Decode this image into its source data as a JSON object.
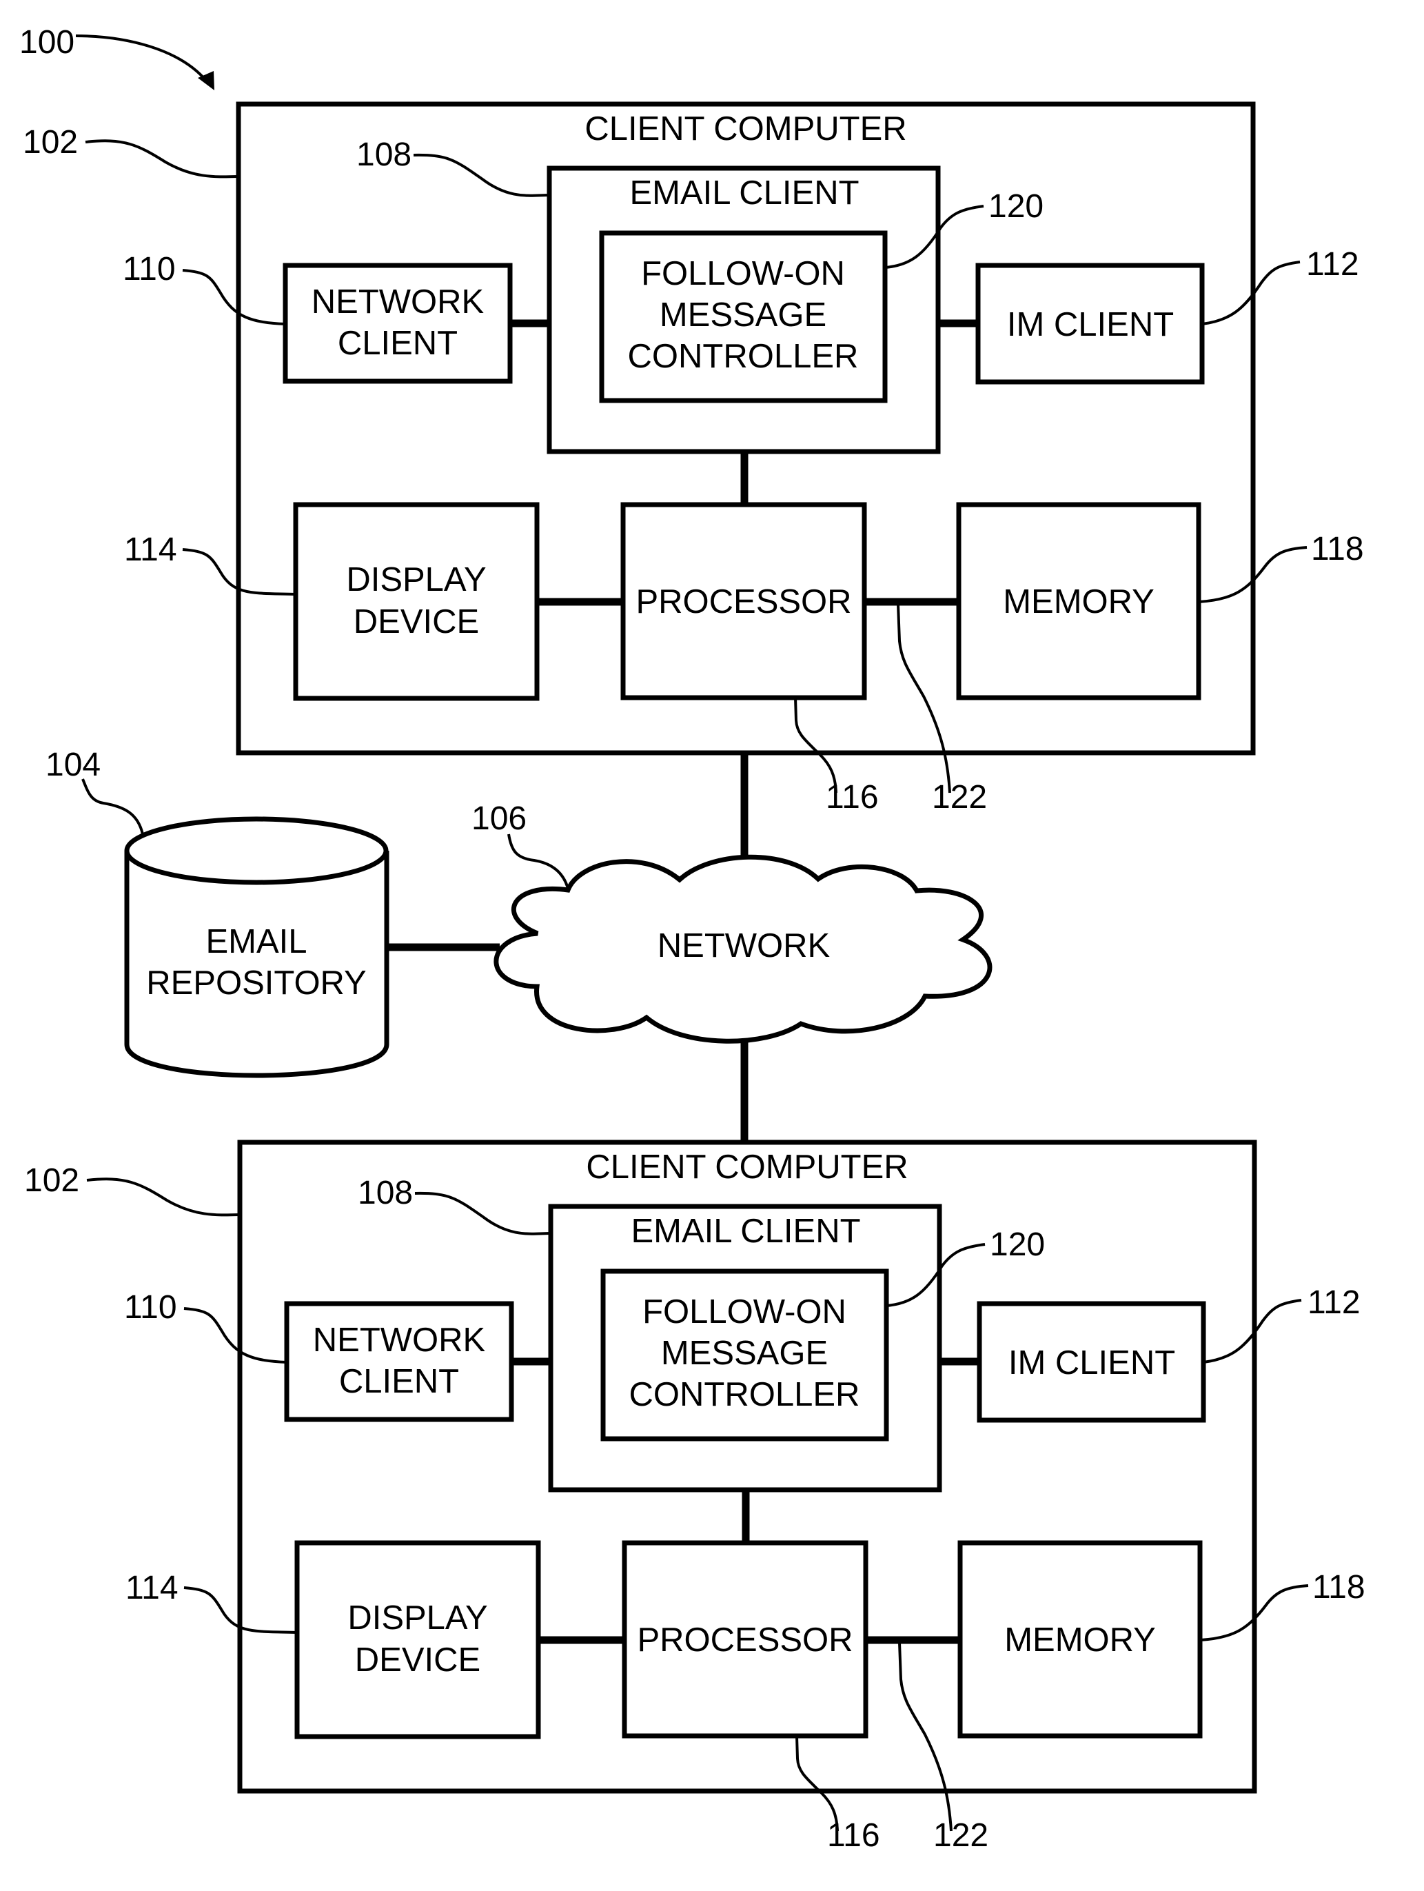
{
  "figure": {
    "reference": "100"
  },
  "network": {
    "label": "NETWORK",
    "ref": "106"
  },
  "repository": {
    "line1": "EMAIL",
    "line2": "REPOSITORY",
    "ref": "104"
  },
  "clients": [
    {
      "title": "CLIENT COMPUTER",
      "ref": "102",
      "email_client": {
        "label": "EMAIL CLIENT",
        "ref": "108"
      },
      "controller": {
        "line1": "FOLLOW-ON",
        "line2": "MESSAGE",
        "line3": "CONTROLLER",
        "ref": "120"
      },
      "network_client": {
        "line1": "NETWORK",
        "line2": "CLIENT",
        "ref": "110"
      },
      "im_client": {
        "label": "IM CLIENT",
        "ref": "112"
      },
      "display_device": {
        "line1": "DISPLAY",
        "line2": "DEVICE",
        "ref": "114"
      },
      "processor": {
        "label": "PROCESSOR",
        "ref": "116"
      },
      "memory": {
        "label": "MEMORY",
        "ref": "118"
      },
      "bus_ref": "122"
    },
    {
      "title": "CLIENT COMPUTER",
      "ref": "102",
      "email_client": {
        "label": "EMAIL CLIENT",
        "ref": "108"
      },
      "controller": {
        "line1": "FOLLOW-ON",
        "line2": "MESSAGE",
        "line3": "CONTROLLER",
        "ref": "120"
      },
      "network_client": {
        "line1": "NETWORK",
        "line2": "CLIENT",
        "ref": "110"
      },
      "im_client": {
        "label": "IM CLIENT",
        "ref": "112"
      },
      "display_device": {
        "line1": "DISPLAY",
        "line2": "DEVICE",
        "ref": "114"
      },
      "processor": {
        "label": "PROCESSOR",
        "ref": "116"
      },
      "memory": {
        "label": "MEMORY",
        "ref": "118"
      },
      "bus_ref": "122"
    }
  ]
}
